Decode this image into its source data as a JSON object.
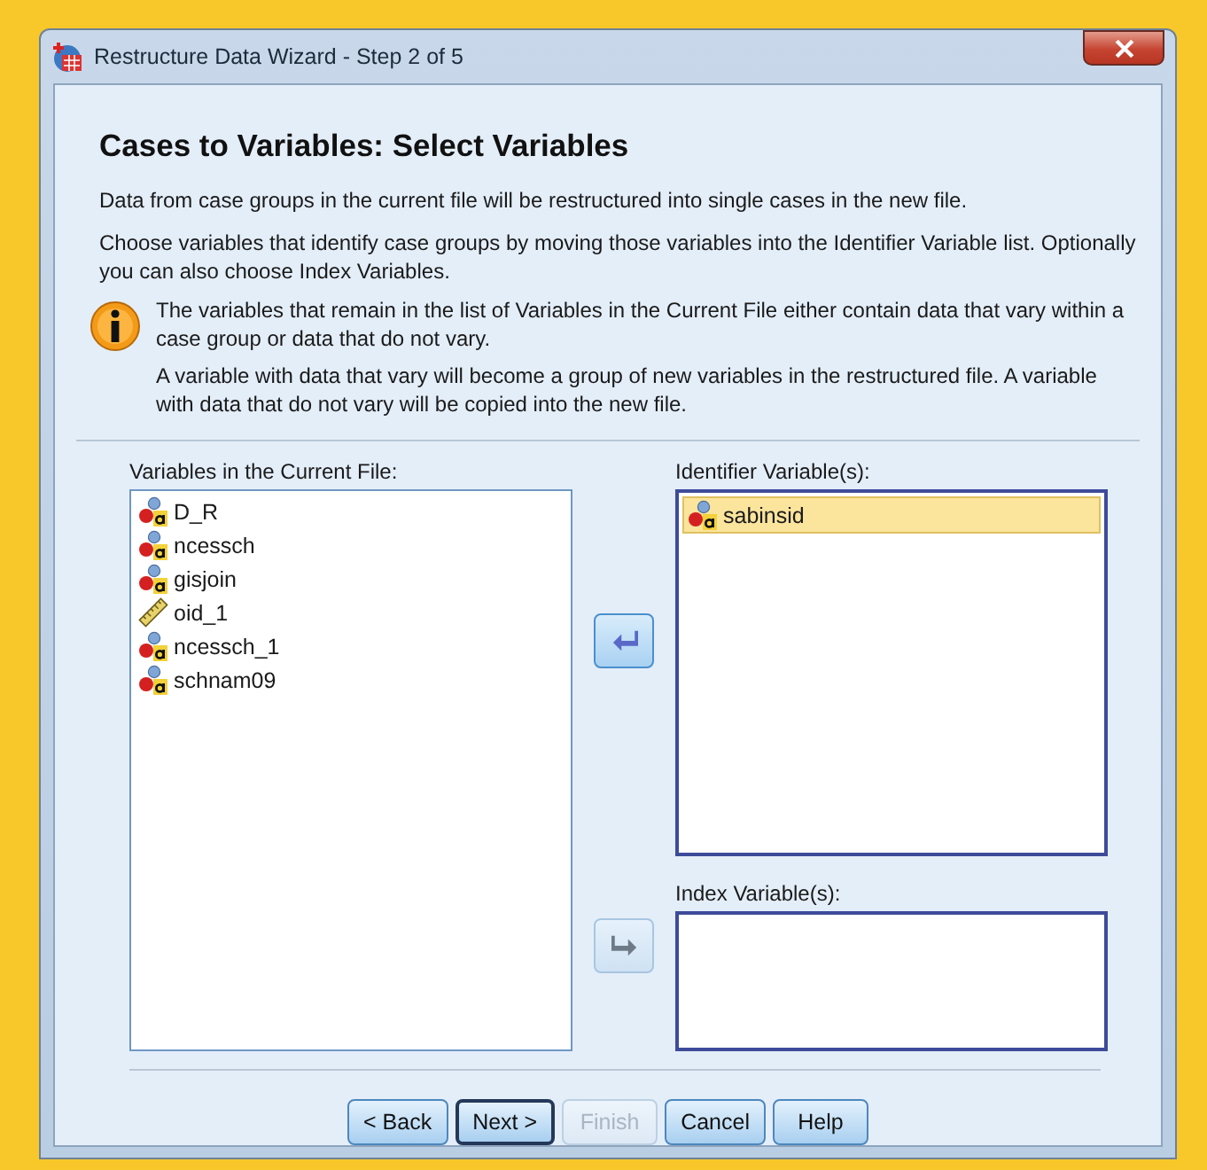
{
  "window": {
    "title": "Restructure Data Wizard - Step 2 of 5"
  },
  "heading": "Cases to Variables: Select Variables",
  "intro": [
    "Data from case groups in the current file will be restructured into single cases in the new file.",
    "Choose variables that identify case groups by moving those variables into the Identifier Variable list. Optionally you can also choose Index Variables."
  ],
  "info": [
    "The variables that remain in the list of Variables in the Current File either contain data that vary within a case group or data that do not vary.",
    "A variable with data that vary will become a group of new variables in the restructured file.  A variable with data that do not vary will be copied into the new file."
  ],
  "current_list": {
    "label": "Variables in the Current File:",
    "items": [
      {
        "name": "D_R",
        "kind": "string",
        "selected": false
      },
      {
        "name": "ncessch",
        "kind": "string",
        "selected": false
      },
      {
        "name": "gisjoin",
        "kind": "string",
        "selected": false
      },
      {
        "name": "oid_1",
        "kind": "scale",
        "selected": false
      },
      {
        "name": "ncessch_1",
        "kind": "string",
        "selected": false
      },
      {
        "name": "schnam09",
        "kind": "string",
        "selected": false
      }
    ]
  },
  "identifier_list": {
    "label": "Identifier Variable(s):",
    "move_enabled": true,
    "items": [
      {
        "name": "sabinsid",
        "kind": "string",
        "selected": true
      }
    ]
  },
  "index_list": {
    "label": "Index Variable(s):",
    "move_enabled": false
  },
  "buttons": [
    {
      "label": "< Back",
      "disabled": false,
      "default": false
    },
    {
      "label": "Next >",
      "disabled": false,
      "default": true
    },
    {
      "label": "Finish",
      "disabled": true,
      "default": false
    },
    {
      "label": "Cancel",
      "disabled": false,
      "default": false
    },
    {
      "label": "Help",
      "disabled": false,
      "default": false
    }
  ]
}
